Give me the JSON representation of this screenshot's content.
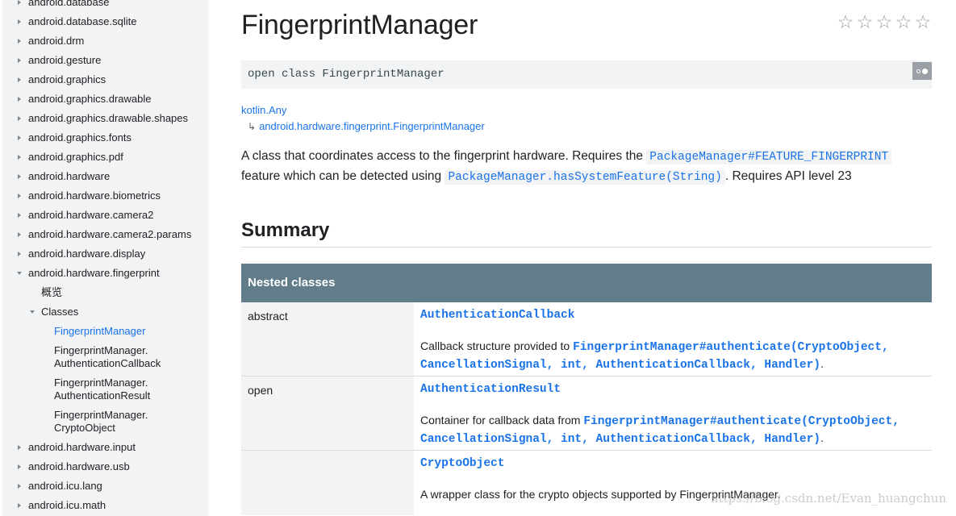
{
  "sidebar": {
    "items": [
      {
        "label": "android.database",
        "level": 0,
        "state": "collapsed"
      },
      {
        "label": "android.database.sqlite",
        "level": 0,
        "state": "collapsed"
      },
      {
        "label": "android.drm",
        "level": 0,
        "state": "collapsed"
      },
      {
        "label": "android.gesture",
        "level": 0,
        "state": "collapsed"
      },
      {
        "label": "android.graphics",
        "level": 0,
        "state": "collapsed"
      },
      {
        "label": "android.graphics.drawable",
        "level": 0,
        "state": "collapsed"
      },
      {
        "label": "android.graphics.drawable.shapes",
        "level": 0,
        "state": "collapsed"
      },
      {
        "label": "android.graphics.fonts",
        "level": 0,
        "state": "collapsed"
      },
      {
        "label": "android.graphics.pdf",
        "level": 0,
        "state": "collapsed"
      },
      {
        "label": "android.hardware",
        "level": 0,
        "state": "collapsed"
      },
      {
        "label": "android.hardware.biometrics",
        "level": 0,
        "state": "collapsed"
      },
      {
        "label": "android.hardware.camera2",
        "level": 0,
        "state": "collapsed"
      },
      {
        "label": "android.hardware.camera2.params",
        "level": 0,
        "state": "collapsed"
      },
      {
        "label": "android.hardware.display",
        "level": 0,
        "state": "collapsed"
      },
      {
        "label": "android.hardware.fingerprint",
        "level": 0,
        "state": "expanded"
      },
      {
        "label": "概览",
        "level": 1,
        "state": "none"
      },
      {
        "label": "Classes",
        "level": 1,
        "state": "expanded"
      },
      {
        "label": "FingerprintManager",
        "level": 2,
        "state": "active"
      },
      {
        "label": "FingerprintManager.\nAuthenticationCallback",
        "level": 2,
        "state": "none"
      },
      {
        "label": "FingerprintManager.\nAuthenticationResult",
        "level": 2,
        "state": "none"
      },
      {
        "label": "FingerprintManager.\nCryptoObject",
        "level": 2,
        "state": "none"
      },
      {
        "label": "android.hardware.input",
        "level": 0,
        "state": "collapsed"
      },
      {
        "label": "android.hardware.usb",
        "level": 0,
        "state": "collapsed"
      },
      {
        "label": "android.icu.lang",
        "level": 0,
        "state": "collapsed"
      },
      {
        "label": "android.icu.math",
        "level": 0,
        "state": "collapsed"
      }
    ]
  },
  "page": {
    "title": "FingerprintManager",
    "rating_icon": "star-outline-icon",
    "rating_count": 5,
    "signature": "open class FingerprintManager",
    "inheritance": [
      "kotlin.Any",
      "android.hardware.fingerprint.FingerprintManager"
    ],
    "inherit_hook": "↳",
    "description": {
      "part1": "A class that coordinates access to the fingerprint hardware. Requires the ",
      "code1": "PackageManager#FEATURE_FINGERPRINT",
      "part2": " feature which can be detected using ",
      "code2": "PackageManager.hasSystemFeature(String)",
      "part3": ". Requires API level 23"
    },
    "summary_title": "Summary"
  },
  "nested_classes": {
    "header": "Nested classes",
    "rows": [
      {
        "modifier": "abstract",
        "name": "AuthenticationCallback",
        "desc_prefix": "Callback structure provided to ",
        "desc_code": "FingerprintManager#authenticate(CryptoObject, CancellationSignal, int, AuthenticationCallback, Handler)",
        "desc_suffix": "."
      },
      {
        "modifier": "open",
        "name": "AuthenticationResult",
        "desc_prefix": "Container for callback data from ",
        "desc_code": "FingerprintManager#authenticate(CryptoObject, CancellationSignal, int, AuthenticationCallback, Handler)",
        "desc_suffix": "."
      },
      {
        "modifier": "",
        "name": "CryptoObject",
        "desc_prefix": "A wrapper class for the crypto objects supported by FingerprintManager.",
        "desc_code": "",
        "desc_suffix": ""
      }
    ]
  },
  "watermark": "https://blog.csdn.net/Evan_huangchun",
  "colors": {
    "link": "#1a73e8",
    "table_header": "#617d8a",
    "sidebar_bg": "#f1f3f4"
  }
}
